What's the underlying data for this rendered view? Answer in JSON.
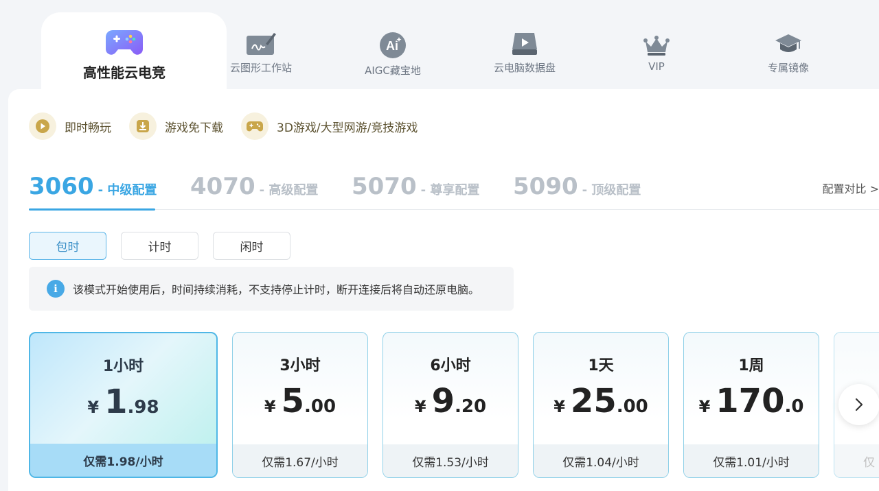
{
  "nav": {
    "items": [
      {
        "label": "高性能云电竞",
        "icon": "gamepad-icon",
        "active": true
      },
      {
        "label": "云图形工作站",
        "icon": "drawing-tablet-icon"
      },
      {
        "label": "AIGC藏宝地",
        "icon": "ai-badge-icon",
        "icon_text": "Ai"
      },
      {
        "label": "云电脑数据盘",
        "icon": "hard-drive-icon"
      },
      {
        "label": "VIP",
        "icon": "crown-icon"
      },
      {
        "label": "专属镜像",
        "icon": "graduation-cap-icon"
      }
    ]
  },
  "features": [
    {
      "text": "即时畅玩",
      "icon": "play-icon"
    },
    {
      "text": "游戏免下载",
      "icon": "download-icon"
    },
    {
      "text": "3D游戏/大型网游/竞技游戏",
      "icon": "gamepad-small-icon"
    }
  ],
  "configs": [
    {
      "num": "3060",
      "name": "- 中级配置",
      "active": true
    },
    {
      "num": "4070",
      "name": "- 高级配置"
    },
    {
      "num": "5070",
      "name": "- 尊享配置"
    },
    {
      "num": "5090",
      "name": "- 顶级配置"
    }
  ],
  "compare_label": "配置对比 >",
  "modes": [
    {
      "label": "包时",
      "active": true
    },
    {
      "label": "计时"
    },
    {
      "label": "闲时"
    }
  ],
  "notice": {
    "icon_text": "i",
    "text": "该模式开始使用后，时间持续消耗，不支持停止计时，断开连接后将自动还原电脑。"
  },
  "cards": [
    {
      "duration": "1小时",
      "yen": "¥",
      "price_int": "1",
      "price_dec": ".98",
      "per_hour": "仅需1.98/小时",
      "active": true
    },
    {
      "duration": "3小时",
      "yen": "¥",
      "price_int": "5",
      "price_dec": ".00",
      "per_hour": "仅需1.67/小时"
    },
    {
      "duration": "6小时",
      "yen": "¥",
      "price_int": "9",
      "price_dec": ".20",
      "per_hour": "仅需1.53/小时"
    },
    {
      "duration": "1天",
      "yen": "¥",
      "price_int": "25",
      "price_dec": ".00",
      "per_hour": "仅需1.04/小时"
    },
    {
      "duration": "1周",
      "yen": "¥",
      "price_int": "170",
      "price_dec": ".0",
      "per_hour": "仅需1.01/小时"
    },
    {
      "duration": "",
      "yen": "",
      "price_int": "",
      "price_dec": "",
      "per_hour": "仅"
    }
  ],
  "colors": {
    "accent": "#3aa6e3",
    "gold_text": "#5c5230",
    "nav_bg": "#f3f5f8"
  }
}
